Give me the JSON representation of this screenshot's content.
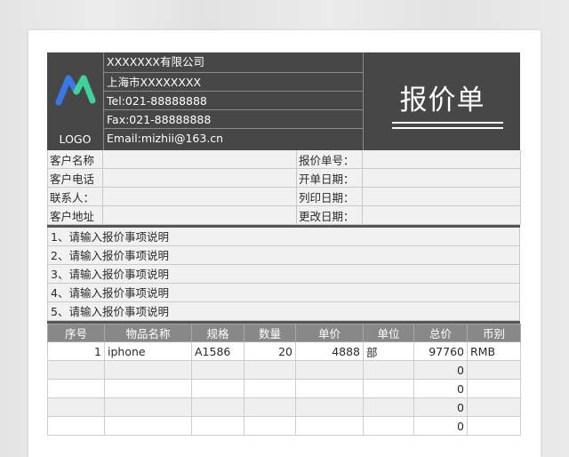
{
  "company": {
    "name": "XXXXXXX有限公司",
    "address": "上海市XXXXXXXX",
    "tel": "Tel:021-88888888",
    "fax": "Fax:021-88888888",
    "email": "Email:mizhii@163.cn",
    "logo_label": "LOGO",
    "logo_colors": [
      "#3b78e7",
      "#3fd39a"
    ]
  },
  "doc_title": "报价单",
  "fields": {
    "customer_name": "客户名称",
    "customer_phone": "客户电话",
    "contact": "联系人：",
    "customer_address": "客户地址",
    "quote_no": "报价单号：",
    "issue_date": "开单日期：",
    "print_date": "列印日期：",
    "modify_date": "更改日期："
  },
  "notes": [
    "1、请输入报价事项说明",
    "2、请输入报价事项说明",
    "3、请输入报价事项说明",
    "4、请输入报价事项说明",
    "5、请输入报价事项说明"
  ],
  "items_table": {
    "headers": [
      "序号",
      "物品名称",
      "规格",
      "数量",
      "单价",
      "单位",
      "总价",
      "币别"
    ],
    "rows": [
      [
        "1",
        "iphone",
        "A1586",
        "20",
        "4888",
        "部",
        "97760",
        "RMB"
      ],
      [
        "",
        "",
        "",
        "",
        "",
        "",
        "0",
        ""
      ],
      [
        "",
        "",
        "",
        "",
        "",
        "",
        "0",
        ""
      ],
      [
        "",
        "",
        "",
        "",
        "",
        "",
        "0",
        ""
      ],
      [
        "",
        "",
        "",
        "",
        "",
        "",
        "0",
        ""
      ]
    ]
  },
  "colors": {
    "header_bg": "#474747",
    "table_header_bg": "#888888",
    "field_bg": "#f1f1f1"
  }
}
